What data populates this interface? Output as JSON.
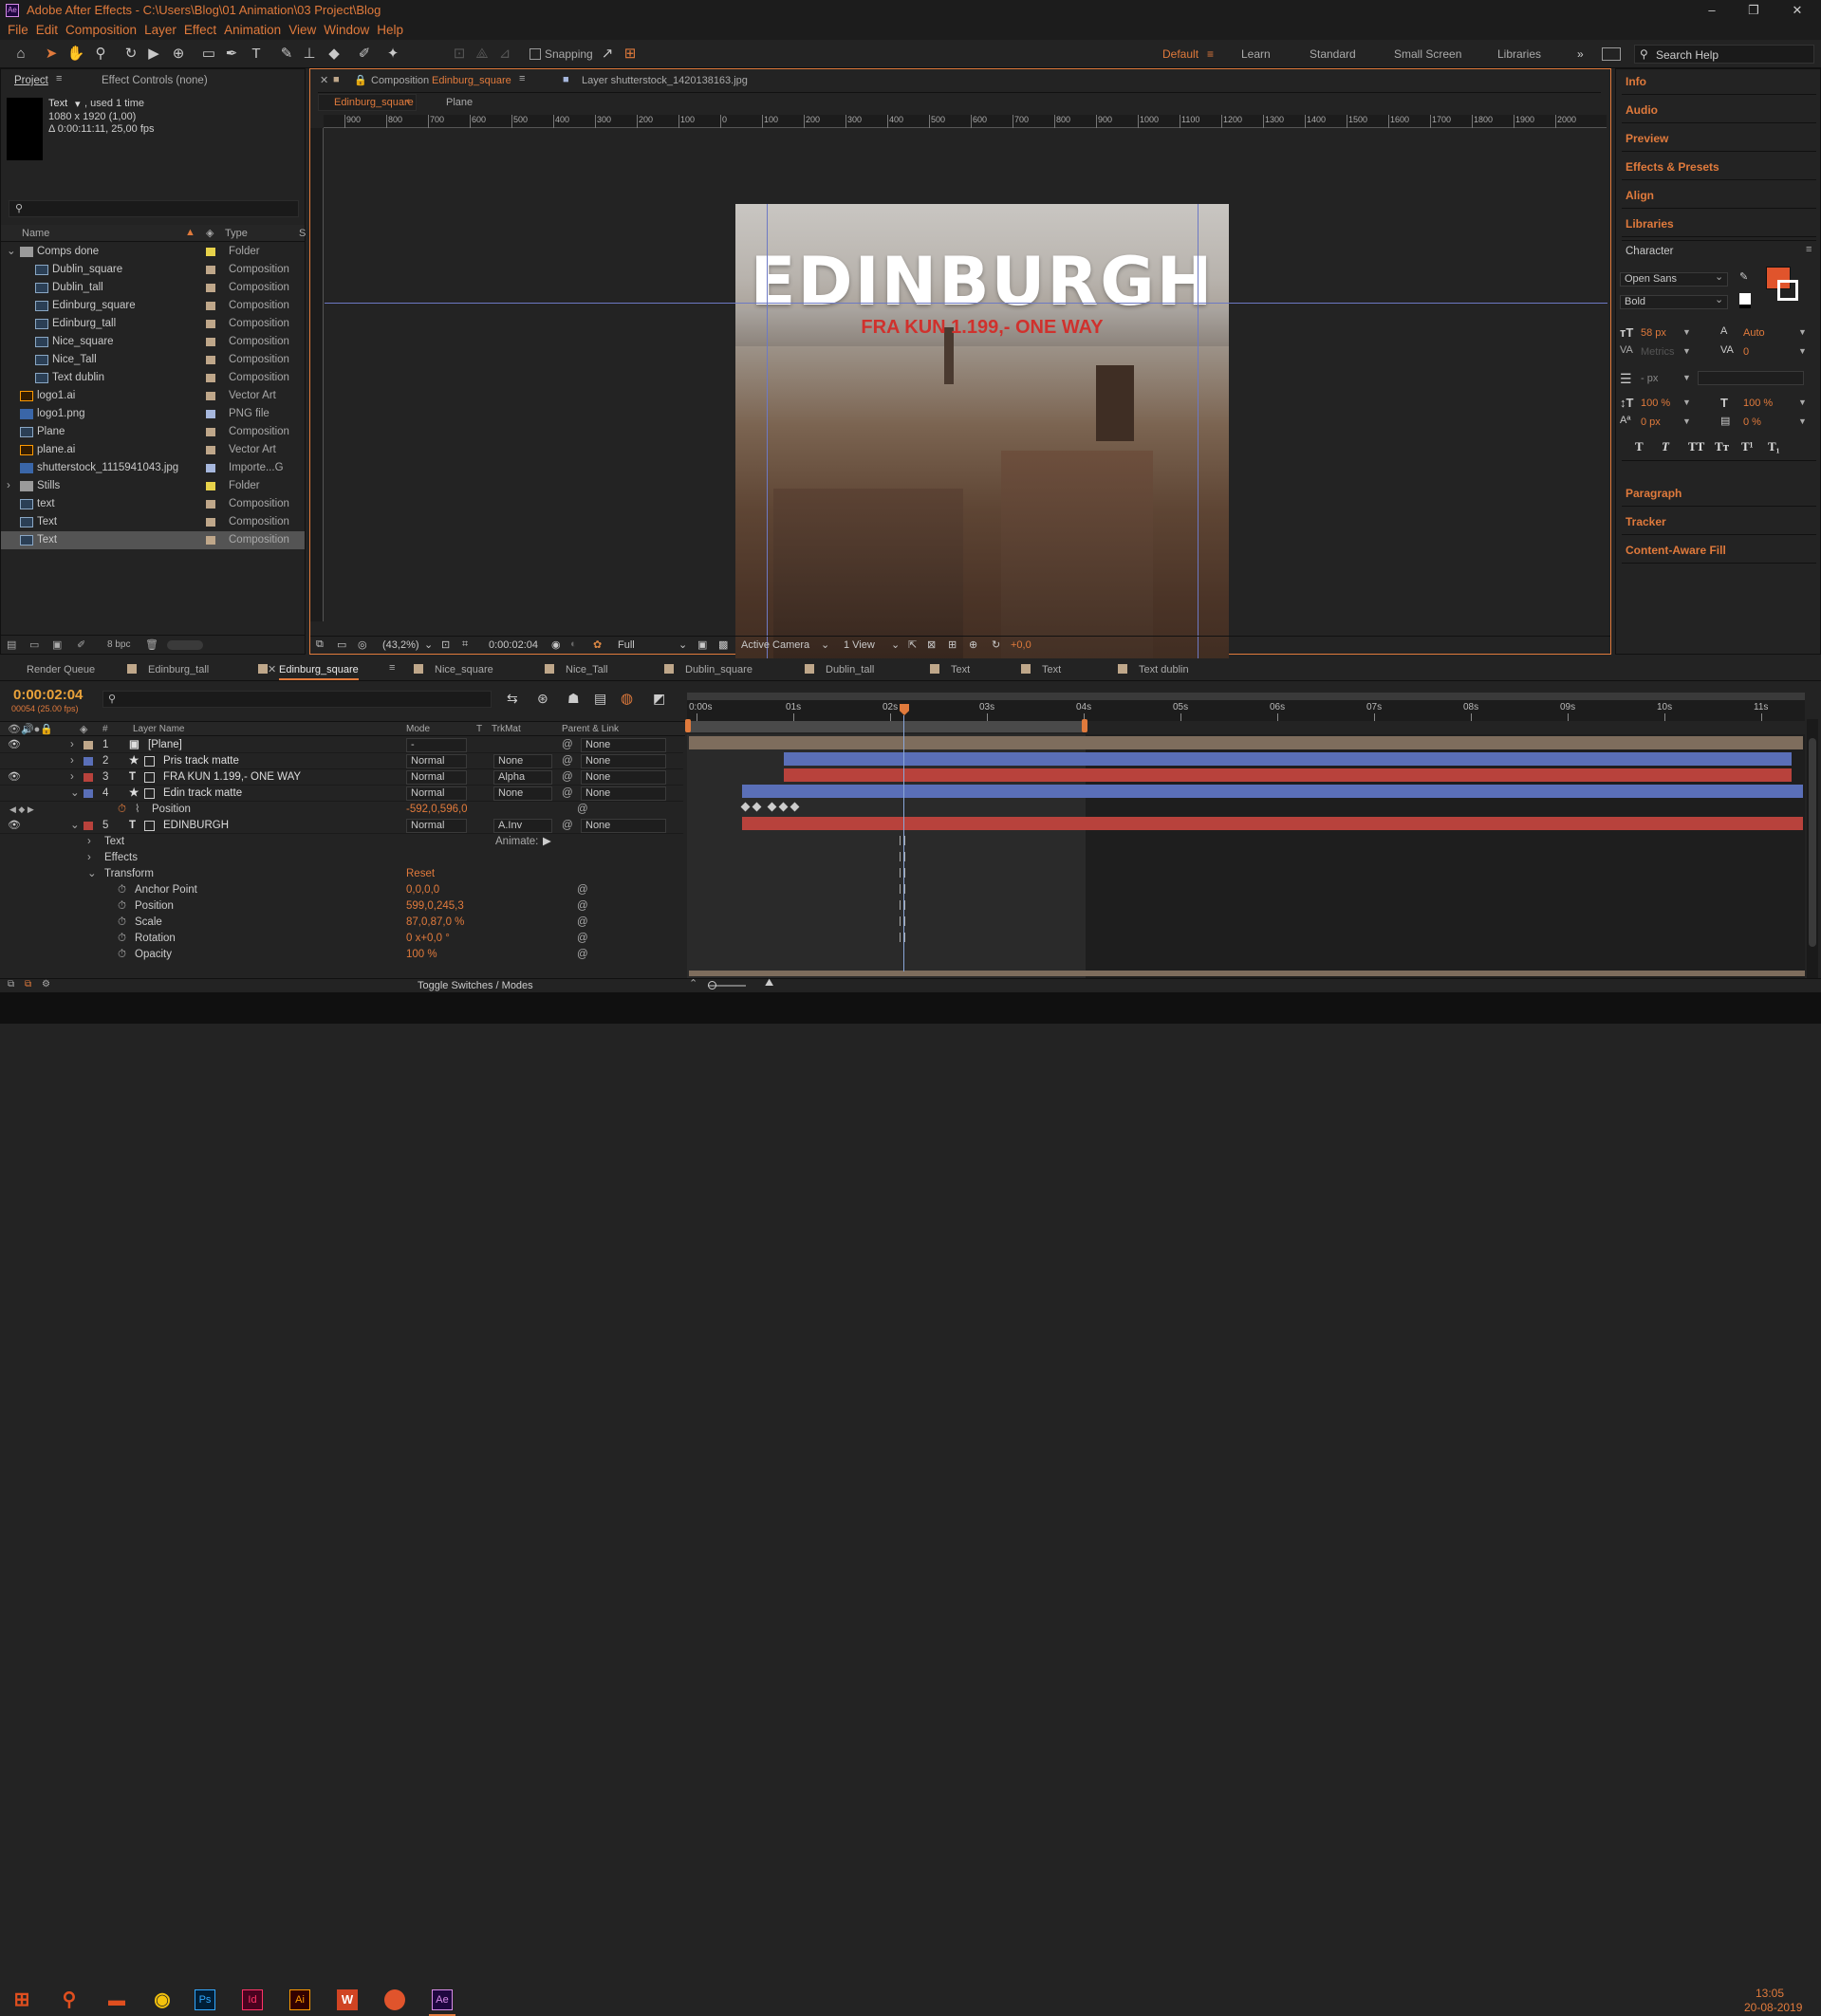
{
  "window": {
    "title": "Adobe After Effects - C:\\Users\\Blog\\01 Animation\\03 Project\\Blog",
    "app_icon": "Ae"
  },
  "menu": [
    "File",
    "Edit",
    "Composition",
    "Layer",
    "Effect",
    "Animation",
    "View",
    "Window",
    "Help"
  ],
  "toolbar": {
    "snapping": "Snapping",
    "workspaces": [
      "Default",
      "Learn",
      "Standard",
      "Small Screen",
      "Libraries"
    ],
    "search_help": "Search Help"
  },
  "project": {
    "tab": "Project",
    "effect_controls": "Effect Controls (none)",
    "sel_name": "Text",
    "sel_used": ", used 1 time",
    "sel_size": "1080 x 1920 (1,00)",
    "sel_dur": "Δ 0:00:11:11, 25,00 fps",
    "col_name": "Name",
    "col_type": "Type",
    "col_s": "S",
    "bpc": "8 bpc",
    "items": [
      {
        "name": "Comps done",
        "type": "Folder",
        "color": "#e7d24a",
        "kind": "folder",
        "indent": 0
      },
      {
        "name": "Dublin_square",
        "type": "Composition",
        "color": "#bfa78a",
        "kind": "comp",
        "indent": 1
      },
      {
        "name": "Dublin_tall",
        "type": "Composition",
        "color": "#bfa78a",
        "kind": "comp",
        "indent": 1
      },
      {
        "name": "Edinburg_square",
        "type": "Composition",
        "color": "#bfa78a",
        "kind": "comp",
        "indent": 1
      },
      {
        "name": "Edinburg_tall",
        "type": "Composition",
        "color": "#bfa78a",
        "kind": "comp",
        "indent": 1
      },
      {
        "name": "Nice_square",
        "type": "Composition",
        "color": "#bfa78a",
        "kind": "comp",
        "indent": 1
      },
      {
        "name": "Nice_Tall",
        "type": "Composition",
        "color": "#bfa78a",
        "kind": "comp",
        "indent": 1
      },
      {
        "name": "Text dublin",
        "type": "Composition",
        "color": "#bfa78a",
        "kind": "comp",
        "indent": 1
      },
      {
        "name": "logo1.ai",
        "type": "Vector Art",
        "color": "#bfa78a",
        "kind": "ai",
        "indent": 0
      },
      {
        "name": "logo1.png",
        "type": "PNG file",
        "color": "#a6b7dd",
        "kind": "img",
        "indent": 0
      },
      {
        "name": "Plane",
        "type": "Composition",
        "color": "#bfa78a",
        "kind": "comp",
        "indent": 0
      },
      {
        "name": "plane.ai",
        "type": "Vector Art",
        "color": "#bfa78a",
        "kind": "ai",
        "indent": 0
      },
      {
        "name": "shutterstock_1115941043.jpg",
        "type": "Importe...G",
        "color": "#a6b7dd",
        "kind": "img",
        "indent": 0
      },
      {
        "name": "Stills",
        "type": "Folder",
        "color": "#e7d24a",
        "kind": "folder",
        "indent": 0
      },
      {
        "name": "text",
        "type": "Composition",
        "color": "#bfa78a",
        "kind": "comp",
        "indent": 0
      },
      {
        "name": "Text",
        "type": "Composition",
        "color": "#bfa78a",
        "kind": "comp",
        "indent": 0
      },
      {
        "name": "Text",
        "type": "Composition",
        "color": "#bfa78a",
        "kind": "comp",
        "indent": 0,
        "selected": true
      }
    ]
  },
  "viewer": {
    "comp_tab_prefix": "Composition",
    "comp_tab_name": "Edinburg_square",
    "layer_tab": "Layer shutterstock_1420138163.jpg",
    "crumb1": "Edinburg_square",
    "crumb2": "Plane",
    "ruler": [
      "900",
      "800",
      "700",
      "600",
      "500",
      "400",
      "300",
      "200",
      "100",
      "0",
      "100",
      "200",
      "300",
      "400",
      "500",
      "600",
      "700",
      "800",
      "900",
      "1000",
      "1100",
      "1200",
      "1300",
      "1400",
      "1500",
      "1600",
      "1700",
      "1800",
      "1900",
      "2000"
    ],
    "headline": "EDINBURGH",
    "subline": "FRA KUN 1.199,- ONE WAY",
    "zoom": "(43,2%)",
    "timecode": "0:00:02:04",
    "resolution": "Full",
    "camera": "Active Camera",
    "views": "1 View",
    "exposure": "+0,0"
  },
  "right": {
    "panels": [
      "Info",
      "Audio",
      "Preview",
      "Effects & Presets",
      "Align",
      "Libraries"
    ],
    "character": "Character",
    "font": "Open Sans",
    "style": "Bold",
    "size": "58 px",
    "leading": "Auto",
    "kern": "Metrics",
    "track": "0",
    "stroke": "- px",
    "vscale": "100 %",
    "hscale": "100 %",
    "baseline": "0 px",
    "tsume": "0 %",
    "styles": [
      "T",
      "T",
      "TT",
      "Tт",
      "T¹",
      "T₁"
    ],
    "bottom": [
      "Paragraph",
      "Tracker",
      "Content-Aware Fill"
    ]
  },
  "timeline": {
    "tabs": [
      "Render Queue",
      "Edinburg_tall",
      "Edinburg_square",
      "Nice_square",
      "Nice_Tall",
      "Dublin_square",
      "Dublin_tall",
      "Text",
      "Text",
      "Text dublin"
    ],
    "time": "0:00:02:04",
    "frames": "00054 (25.00 fps)",
    "col_layer": "Layer Name",
    "col_mode": "Mode",
    "col_t": "T",
    "col_trk": "TrkMat",
    "col_parent": "Parent & Link",
    "ticks": [
      "0:00s",
      "01s",
      "02s",
      "03s",
      "04s",
      "05s",
      "06s",
      "07s",
      "08s",
      "09s",
      "10s",
      "11s"
    ],
    "layers": [
      {
        "n": "1",
        "name": "[Plane]",
        "color": "#bfa78a",
        "mode": "-",
        "trk": "",
        "parent": "None",
        "type": "comp"
      },
      {
        "n": "2",
        "name": "Pris track matte",
        "color": "#5a6fb8",
        "mode": "Normal",
        "trk": "None",
        "parent": "None",
        "type": "star"
      },
      {
        "n": "3",
        "name": "FRA KUN 1.199,- ONE WAY",
        "color": "#b8423c",
        "mode": "Normal",
        "trk": "Alpha",
        "parent": "None",
        "type": "text"
      },
      {
        "n": "4",
        "name": "Edin track matte",
        "color": "#5a6fb8",
        "mode": "Normal",
        "trk": "None",
        "parent": "None",
        "type": "star"
      },
      {
        "n": "5",
        "name": "EDINBURGH",
        "color": "#b8423c",
        "mode": "Normal",
        "trk": "A.Inv",
        "parent": "None",
        "type": "text"
      }
    ],
    "position_label": "Position",
    "position_value": "-592,0,596,0",
    "props": [
      {
        "name": "Text",
        "value": "",
        "level": 1,
        "arrow": true
      },
      {
        "name": "Effects",
        "value": "",
        "level": 1,
        "arrow": true
      },
      {
        "name": "Transform",
        "value": "Reset",
        "level": 1,
        "arrow": true
      },
      {
        "name": "Anchor Point",
        "value": "0,0,0,0",
        "level": 2
      },
      {
        "name": "Position",
        "value": "599,0,245,3",
        "level": 2
      },
      {
        "name": "Scale",
        "value": "87,0,87,0 %",
        "level": 2
      },
      {
        "name": "Rotation",
        "value": "0 x+0,0 °",
        "level": 2
      },
      {
        "name": "Opacity",
        "value": "100 %",
        "level": 2
      }
    ],
    "animate": "Animate:",
    "toggle": "Toggle Switches / Modes"
  },
  "taskbar": {
    "apps": [
      "Ps",
      "Id",
      "Ai",
      "W",
      "Ae"
    ],
    "time": "13:05",
    "date": "20-08-2019"
  }
}
